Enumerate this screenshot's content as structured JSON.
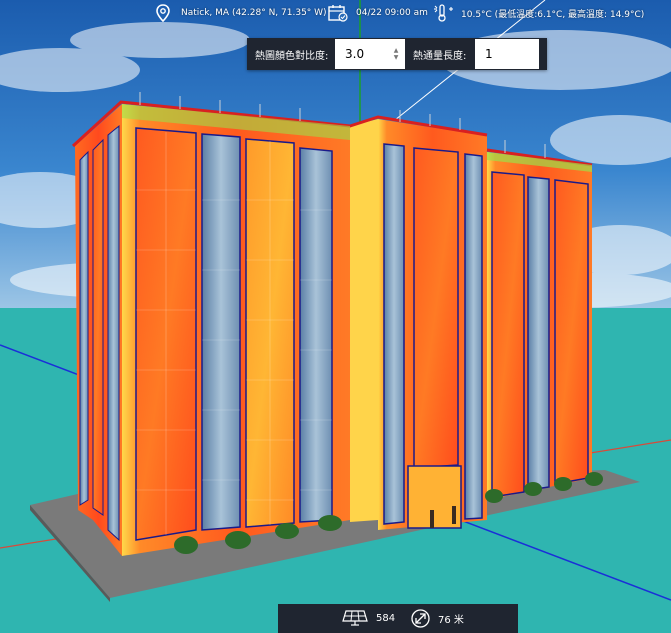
{
  "topbar": {
    "location": "Natick, MA (42.28° N, 71.35° W)",
    "datetime": "04/22 09:00 am",
    "weather": "10.5°C (最低溫度:6.1°C, 最高溫度: 14.9°C)",
    "icons": [
      "location-pin-icon",
      "calendar-icon",
      "thermometer-sun-icon"
    ]
  },
  "controls": {
    "heatmap_ratio_label": "熱圖顏色對比度:",
    "heatmap_ratio_value": "3.0",
    "flux_length_label": "熱通量長度:",
    "flux_length_value": "1"
  },
  "status": {
    "panel_count": "584",
    "distance": "76 米",
    "icons": [
      "solar-panel-icon",
      "resize-arrow-icon"
    ]
  },
  "colors": {
    "ground": "#2fb5b0",
    "sky": "#1f63b8",
    "heat_hot": "#ff4b1f",
    "heat_warm": "#ffa02a",
    "heat_cool": "#ffe44a",
    "toolbar_bg": "#1f2530"
  }
}
